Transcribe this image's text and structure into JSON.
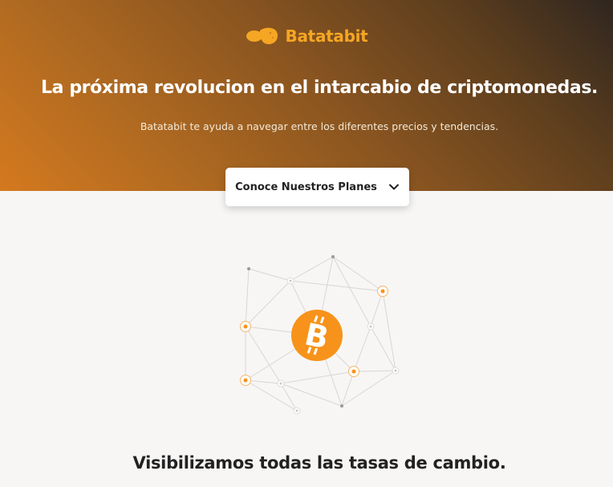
{
  "brand": {
    "name": "Batatabit",
    "logo_icon": "potato-logo-icon"
  },
  "hero": {
    "title": "La próxima revolucion en el intarcabio de criptomonedas.",
    "subtitle": "Batatabit te ayuda a navegar entre los diferentes precios y tendencias.",
    "cta_label": "Conoce Nuestros Planes",
    "cta_icon": "chevron-down-icon"
  },
  "illustration": {
    "icon": "bitcoin-network-icon"
  },
  "section": {
    "title": "Visibilizamos todas las tasas de cambio."
  },
  "colors": {
    "accent": "#f5a623",
    "bitcoin_orange": "#f7931a",
    "hero_gradient_start": "#d4791f",
    "hero_gradient_end": "#2f2620",
    "background": "#f7f6f5"
  }
}
